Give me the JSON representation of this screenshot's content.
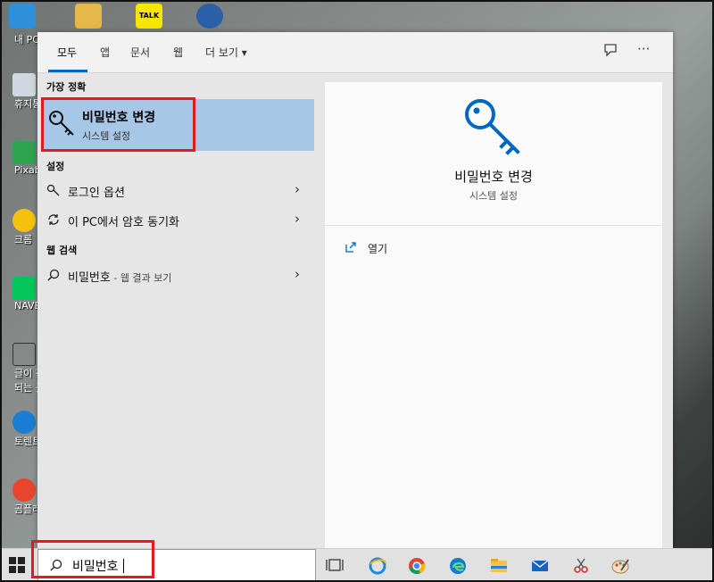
{
  "desktop": {
    "icons": [
      "내 PC",
      "휴지통",
      "Pixaba",
      "크롬",
      "NAVER",
      "글이 작",
      "되는 곳",
      "토렌트",
      "곰플레이"
    ]
  },
  "menu": {
    "tabs": [
      "모두",
      "앱",
      "문서",
      "웹",
      "더 보기"
    ],
    "more_caret": "▾",
    "feedback_icon": "feedback-icon",
    "more_dots": "···",
    "best_match_header": "가장 정확",
    "best_match": {
      "title": "비밀번호 변경",
      "subtitle": "시스템 설정"
    },
    "settings_header": "설정",
    "settings_items": [
      {
        "label": "로그인 옵션"
      },
      {
        "label": "이 PC에서 암호 동기화"
      }
    ],
    "web_header": "웹 검색",
    "web_item": {
      "label": "비밀번호",
      "suffix": " - 웹 결과 보기"
    },
    "chevron": "›",
    "detail": {
      "title": "비밀번호 변경",
      "subtitle": "시스템 설정",
      "open_label": "열기"
    }
  },
  "taskbar": {
    "search_value": "비밀번호"
  },
  "colors": {
    "accent": "#0067c0",
    "selection": "#a7c7e6",
    "highlight": "#e01b24"
  }
}
